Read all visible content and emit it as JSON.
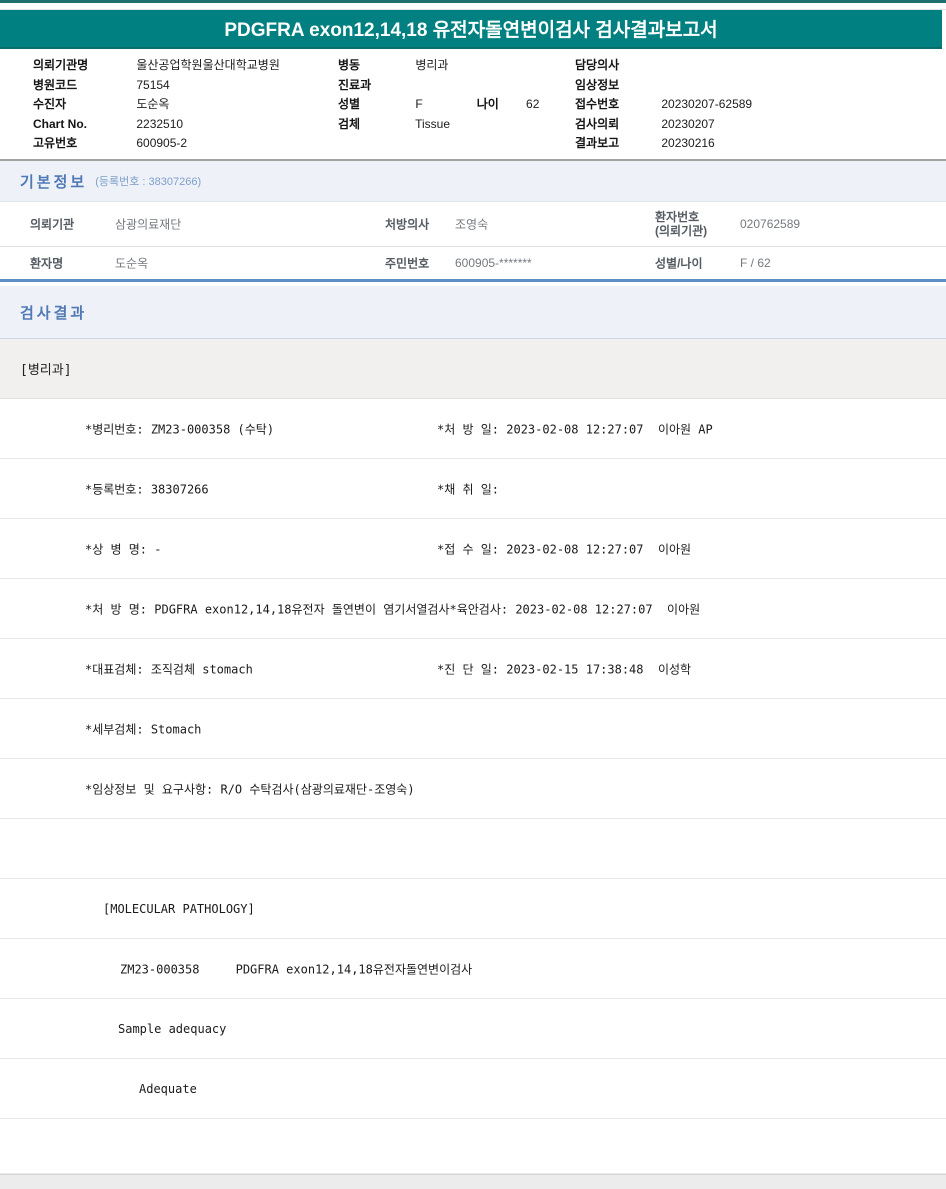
{
  "report": {
    "title": "PDGFRA exon12,14,18 유전자돌연변이검사 검사결과보고서"
  },
  "patient_header": {
    "left": [
      {
        "label": "의뢰기관명",
        "value": "울산공업학원울산대학교병원"
      },
      {
        "label": "병원코드",
        "value": "75154"
      },
      {
        "label": "수진자",
        "value": "도순옥"
      },
      {
        "label": "Chart No.",
        "value": "2232510"
      },
      {
        "label": "고유번호",
        "value": "600905-2"
      }
    ],
    "middle": [
      {
        "label": "병동",
        "value": "병리과"
      },
      {
        "label": "진료과",
        "value": ""
      },
      {
        "label": "성별",
        "value": "F",
        "label2": "나이",
        "value2": "62"
      },
      {
        "label": "검체",
        "value": "Tissue"
      }
    ],
    "right": [
      {
        "label": "담당의사",
        "value": ""
      },
      {
        "label": "임상정보",
        "value": ""
      },
      {
        "label": "접수번호",
        "value": "20230207-62589"
      },
      {
        "label": "검사의뢰",
        "value": "20230207"
      },
      {
        "label": "결과보고",
        "value": "20230216"
      }
    ]
  },
  "basic_info": {
    "title": "기본정보",
    "subtitle": "(등록번호 : 38307266)",
    "row1": {
      "l1": "의뢰기관",
      "v1": "삼광의료재단",
      "l2": "처방의사",
      "v2": "조영숙",
      "l3a": "환자번호",
      "l3b": "(의뢰기관)",
      "v3": "020762589"
    },
    "row2": {
      "l1": "환자명",
      "v1": "도순옥",
      "l2": "주민번호",
      "v2": "600905-*******",
      "l3": "성별/나이",
      "v3": "F / 62"
    }
  },
  "results": {
    "title": "검사결과",
    "department": "[병리과]",
    "rows": [
      {
        "left": "*병리번호: ZM23-000358 (수탁)",
        "right": "*처 방 일: 2023-02-08 12:27:07  이아원 AP"
      },
      {
        "left": "*등록번호: 38307266",
        "right": "*채 취 일:"
      },
      {
        "left": "*상 병 명: -",
        "right": "*접 수 일: 2023-02-08 12:27:07  이아원"
      },
      {
        "left": "*처 방 명: PDGFRA exon12,14,18유전자 돌연변이 염기서열검사*육안검사: 2023-02-08 12:27:07  이아원",
        "right": ""
      },
      {
        "left": "*대표검체: 조직검체 stomach",
        "right": "*진 단 일: 2023-02-15 17:38:48  이성학"
      },
      {
        "left": "*세부검체: Stomach",
        "right": ""
      },
      {
        "left": "*임상정보 및 요구사항: R/O 수탁검사(삼광의료재단-조영숙)",
        "right": ""
      },
      {
        "left": "",
        "right": ""
      },
      {
        "left": "[MOLECULAR PATHOLOGY]",
        "right": ""
      },
      {
        "left": "ZM23-000358     PDGFRA exon12,14,18유전자돌연변이검사",
        "right": ""
      },
      {
        "left": "Sample adequacy",
        "right": ""
      },
      {
        "left": "Adequate",
        "right": ""
      },
      {
        "left": "",
        "right": ""
      }
    ]
  }
}
